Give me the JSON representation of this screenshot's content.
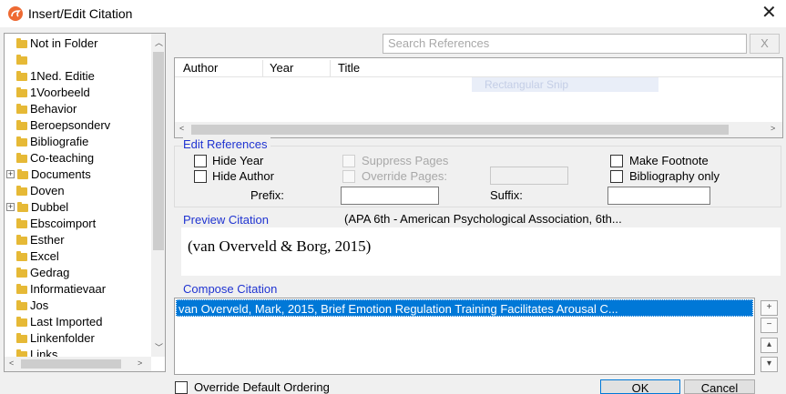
{
  "window": {
    "title": "Insert/Edit Citation",
    "close_glyph": "✕"
  },
  "folders": {
    "items": [
      {
        "label": "Not in Folder",
        "expander": ""
      },
      {
        "label": "",
        "expander": ""
      },
      {
        "label": "1Ned. Editie",
        "expander": ""
      },
      {
        "label": "1Voorbeeld",
        "expander": ""
      },
      {
        "label": "Behavior",
        "expander": ""
      },
      {
        "label": "Beroepsonderv",
        "expander": ""
      },
      {
        "label": "Bibliografie",
        "expander": ""
      },
      {
        "label": "Co-teaching",
        "expander": ""
      },
      {
        "label": "Documents",
        "expander": "+"
      },
      {
        "label": "Doven",
        "expander": ""
      },
      {
        "label": "Dubbel",
        "expander": "+"
      },
      {
        "label": "Ebscoimport",
        "expander": ""
      },
      {
        "label": "Esther",
        "expander": ""
      },
      {
        "label": "Excel",
        "expander": ""
      },
      {
        "label": "Gedrag",
        "expander": ""
      },
      {
        "label": "Informatievaar",
        "expander": ""
      },
      {
        "label": "Jos",
        "expander": ""
      },
      {
        "label": "Last Imported",
        "expander": ""
      },
      {
        "label": "Linkenfolder",
        "expander": ""
      },
      {
        "label": "Links",
        "expander": ""
      }
    ]
  },
  "search": {
    "placeholder": "Search References",
    "clear_label": "X"
  },
  "references": {
    "columns": [
      "Author",
      "Year",
      "Title"
    ],
    "ghost_drag_label": "Rectangular Snip"
  },
  "edit_refs": {
    "title": "Edit References",
    "hide_year": "Hide Year",
    "hide_author": "Hide Author",
    "suppress_pages": "Suppress Pages",
    "override_pages": "Override Pages:",
    "make_footnote": "Make Footnote",
    "bibliography_only": "Bibliography only",
    "prefix_label": "Prefix:",
    "suffix_label": "Suffix:",
    "prefix_value": "",
    "suffix_value": "",
    "override_pages_value": ""
  },
  "preview": {
    "title": "Preview Citation",
    "style": "(APA 6th - American Psychological Association, 6th...",
    "text": "(van Overveld & Borg, 2015)"
  },
  "compose": {
    "title": "Compose Citation",
    "items": [
      "van Overveld, Mark, 2015, Brief Emotion Regulation Training Facilitates Arousal C..."
    ],
    "side_buttons": [
      "+",
      "−",
      "▴",
      "▾"
    ]
  },
  "footer": {
    "override_ordering": "Override Default Ordering",
    "ok": "OK",
    "cancel": "Cancel"
  },
  "colors": {
    "selection": "#0078d7",
    "group_title": "#1f33d1",
    "folder": "#e6b936"
  }
}
